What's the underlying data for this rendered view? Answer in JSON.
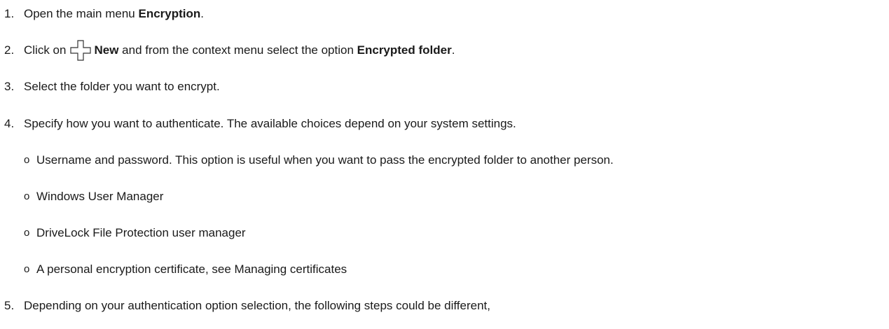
{
  "steps": [
    {
      "num": "1.",
      "text_a": "Open the main menu ",
      "bold_a": "Encryption",
      "text_b": "."
    },
    {
      "num": "2.",
      "text_a": "Click on",
      "icon": "plus-icon",
      "bold_a": "New",
      "text_b": " and from the context menu select the option ",
      "bold_b": "Encrypted folder",
      "text_c": "."
    },
    {
      "num": "3.",
      "text_a": "Select the folder you want to encrypt."
    },
    {
      "num": "4.",
      "text_a": "Specify how you want to authenticate. The available choices depend on your system settings.",
      "sub_bullet": "o",
      "sub_items": [
        "Username and password. This option is useful when you want to pass the encrypted folder to another person.",
        "Windows User Manager",
        "DriveLock File Protection user manager",
        "A personal encryption certificate, see Managing certificates"
      ]
    },
    {
      "num": "5.",
      "text_a": "Depending on your authentication option selection, the following steps could be different,"
    }
  ]
}
